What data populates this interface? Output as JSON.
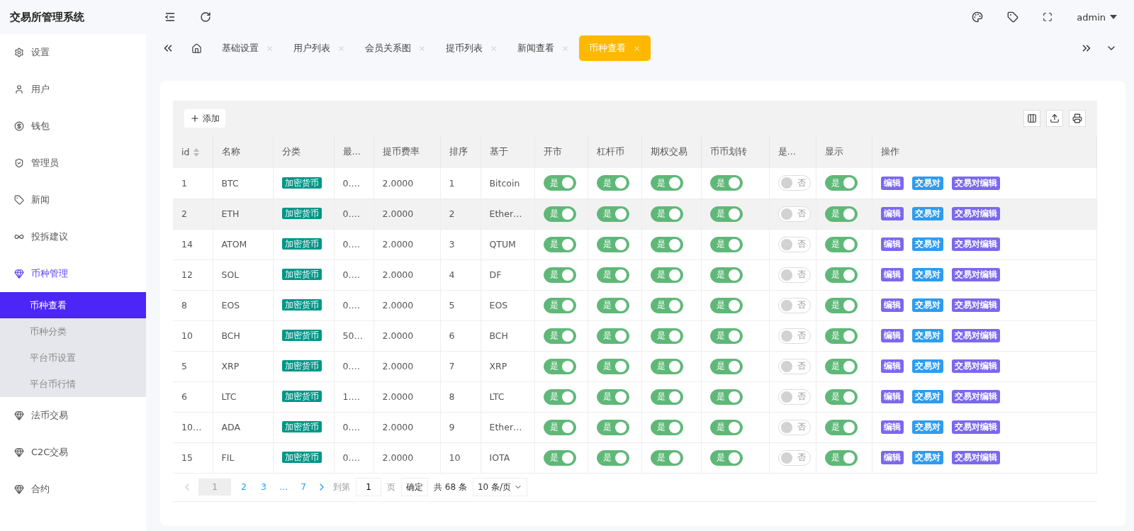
{
  "app": {
    "title": "交易所管理系统"
  },
  "header": {
    "user": "admin"
  },
  "sidebar": {
    "items": [
      {
        "label": "设置",
        "expanded": false
      },
      {
        "label": "用户",
        "expanded": false
      },
      {
        "label": "钱包",
        "expanded": false
      },
      {
        "label": "管理员",
        "expanded": false
      },
      {
        "label": "新闻",
        "expanded": false
      },
      {
        "label": "投拆建议",
        "expanded": false
      },
      {
        "label": "币种管理",
        "expanded": true,
        "children": [
          {
            "label": "币种查看",
            "selected": true
          },
          {
            "label": "币种分类",
            "selected": false
          },
          {
            "label": "平台币设置",
            "selected": false
          },
          {
            "label": "平台币行情",
            "selected": false
          }
        ]
      },
      {
        "label": "法币交易",
        "expanded": false
      },
      {
        "label": "C2C交易",
        "expanded": false
      },
      {
        "label": "合约",
        "expanded": false
      }
    ]
  },
  "tabs": [
    {
      "label": "基础设置",
      "selected": false
    },
    {
      "label": "用户列表",
      "selected": false
    },
    {
      "label": "会员关系图",
      "selected": false
    },
    {
      "label": "提币列表",
      "selected": false
    },
    {
      "label": "新闻查看",
      "selected": false
    },
    {
      "label": "币种查看",
      "selected": true
    }
  ],
  "toolbar": {
    "add": "添加"
  },
  "table": {
    "columns": [
      {
        "label": "id",
        "sortable": true
      },
      {
        "label": "名称",
        "sortable": false
      },
      {
        "label": "分类",
        "sortable": false
      },
      {
        "label": "最…",
        "sortable": false
      },
      {
        "label": "提币费率",
        "sortable": false
      },
      {
        "label": "排序",
        "sortable": false
      },
      {
        "label": "基于",
        "sortable": false
      },
      {
        "label": "开市",
        "sortable": false
      },
      {
        "label": "杠杆币",
        "sortable": false
      },
      {
        "label": "期权交易",
        "sortable": false
      },
      {
        "label": "币币划转",
        "sortable": false
      },
      {
        "label": "是…",
        "sortable": false
      },
      {
        "label": "显示",
        "sortable": false
      },
      {
        "label": "操作",
        "sortable": false
      }
    ],
    "rows": [
      {
        "hovered": false,
        "id": "1",
        "name": "BTC",
        "category": "加密货币",
        "column_4": "0.…",
        "fee": "2.0000",
        "order": "1",
        "base": "Bitcoin",
        "switches": [
          {
            "label": "是",
            "on": true
          },
          {
            "label": "是",
            "on": true
          },
          {
            "label": "是",
            "on": true
          },
          {
            "label": "是",
            "on": true
          },
          {
            "label": "否",
            "on": false
          },
          {
            "label": "是",
            "on": true
          }
        ],
        "actions": [
          {
            "label": "编辑",
            "kind": "edit"
          },
          {
            "label": "交易对",
            "kind": "pairs"
          },
          {
            "label": "交易对编辑",
            "kind": "edit"
          }
        ]
      },
      {
        "hovered": true,
        "id": "2",
        "name": "ETH",
        "category": "加密货币",
        "column_4": "0.…",
        "fee": "2.0000",
        "order": "2",
        "base": "Ether…",
        "switches": [
          {
            "label": "是",
            "on": true
          },
          {
            "label": "是",
            "on": true
          },
          {
            "label": "是",
            "on": true
          },
          {
            "label": "是",
            "on": true
          },
          {
            "label": "否",
            "on": false
          },
          {
            "label": "是",
            "on": true
          }
        ],
        "actions": [
          {
            "label": "编辑",
            "kind": "edit"
          },
          {
            "label": "交易对",
            "kind": "pairs"
          },
          {
            "label": "交易对编辑",
            "kind": "edit"
          }
        ]
      },
      {
        "hovered": false,
        "id": "14",
        "name": "ATOM",
        "category": "加密货币",
        "column_4": "0.…",
        "fee": "2.0000",
        "order": "3",
        "base": "QTUM",
        "switches": [
          {
            "label": "是",
            "on": true
          },
          {
            "label": "是",
            "on": true
          },
          {
            "label": "是",
            "on": true
          },
          {
            "label": "是",
            "on": true
          },
          {
            "label": "否",
            "on": false
          },
          {
            "label": "是",
            "on": true
          }
        ],
        "actions": [
          {
            "label": "编辑",
            "kind": "edit"
          },
          {
            "label": "交易对",
            "kind": "pairs"
          },
          {
            "label": "交易对编辑",
            "kind": "edit"
          }
        ]
      },
      {
        "hovered": false,
        "id": "12",
        "name": "SOL",
        "category": "加密货币",
        "column_4": "0.…",
        "fee": "2.0000",
        "order": "4",
        "base": "DF",
        "switches": [
          {
            "label": "是",
            "on": true
          },
          {
            "label": "是",
            "on": true
          },
          {
            "label": "是",
            "on": true
          },
          {
            "label": "是",
            "on": true
          },
          {
            "label": "否",
            "on": false
          },
          {
            "label": "是",
            "on": true
          }
        ],
        "actions": [
          {
            "label": "编辑",
            "kind": "edit"
          },
          {
            "label": "交易对",
            "kind": "pairs"
          },
          {
            "label": "交易对编辑",
            "kind": "edit"
          }
        ]
      },
      {
        "hovered": false,
        "id": "8",
        "name": "EOS",
        "category": "加密货币",
        "column_4": "0.…",
        "fee": "2.0000",
        "order": "5",
        "base": "EOS",
        "switches": [
          {
            "label": "是",
            "on": true
          },
          {
            "label": "是",
            "on": true
          },
          {
            "label": "是",
            "on": true
          },
          {
            "label": "是",
            "on": true
          },
          {
            "label": "否",
            "on": false
          },
          {
            "label": "是",
            "on": true
          }
        ],
        "actions": [
          {
            "label": "编辑",
            "kind": "edit"
          },
          {
            "label": "交易对",
            "kind": "pairs"
          },
          {
            "label": "交易对编辑",
            "kind": "edit"
          }
        ]
      },
      {
        "hovered": false,
        "id": "10",
        "name": "BCH",
        "category": "加密货币",
        "column_4": "50…",
        "fee": "2.0000",
        "order": "6",
        "base": "BCH",
        "switches": [
          {
            "label": "是",
            "on": true
          },
          {
            "label": "是",
            "on": true
          },
          {
            "label": "是",
            "on": true
          },
          {
            "label": "是",
            "on": true
          },
          {
            "label": "否",
            "on": false
          },
          {
            "label": "是",
            "on": true
          }
        ],
        "actions": [
          {
            "label": "编辑",
            "kind": "edit"
          },
          {
            "label": "交易对",
            "kind": "pairs"
          },
          {
            "label": "交易对编辑",
            "kind": "edit"
          }
        ]
      },
      {
        "hovered": false,
        "id": "5",
        "name": "XRP",
        "category": "加密货币",
        "column_4": "0.…",
        "fee": "2.0000",
        "order": "7",
        "base": "XRP",
        "switches": [
          {
            "label": "是",
            "on": true
          },
          {
            "label": "是",
            "on": true
          },
          {
            "label": "是",
            "on": true
          },
          {
            "label": "是",
            "on": true
          },
          {
            "label": "否",
            "on": false
          },
          {
            "label": "是",
            "on": true
          }
        ],
        "actions": [
          {
            "label": "编辑",
            "kind": "edit"
          },
          {
            "label": "交易对",
            "kind": "pairs"
          },
          {
            "label": "交易对编辑",
            "kind": "edit"
          }
        ]
      },
      {
        "hovered": false,
        "id": "6",
        "name": "LTC",
        "category": "加密货币",
        "column_4": "1.…",
        "fee": "2.0000",
        "order": "8",
        "base": "LTC",
        "switches": [
          {
            "label": "是",
            "on": true
          },
          {
            "label": "是",
            "on": true
          },
          {
            "label": "是",
            "on": true
          },
          {
            "label": "是",
            "on": true
          },
          {
            "label": "否",
            "on": false
          },
          {
            "label": "是",
            "on": true
          }
        ],
        "actions": [
          {
            "label": "编辑",
            "kind": "edit"
          },
          {
            "label": "交易对",
            "kind": "pairs"
          },
          {
            "label": "交易对编辑",
            "kind": "edit"
          }
        ]
      },
      {
        "hovered": false,
        "id": "10…",
        "name": "ADA",
        "category": "加密货币",
        "column_4": "0.…",
        "fee": "2.0000",
        "order": "9",
        "base": "Ether…",
        "switches": [
          {
            "label": "是",
            "on": true
          },
          {
            "label": "是",
            "on": true
          },
          {
            "label": "是",
            "on": true
          },
          {
            "label": "是",
            "on": true
          },
          {
            "label": "否",
            "on": false
          },
          {
            "label": "是",
            "on": true
          }
        ],
        "actions": [
          {
            "label": "编辑",
            "kind": "edit"
          },
          {
            "label": "交易对",
            "kind": "pairs"
          },
          {
            "label": "交易对编辑",
            "kind": "edit"
          }
        ]
      },
      {
        "hovered": false,
        "id": "15",
        "name": "FIL",
        "category": "加密货币",
        "column_4": "0.…",
        "fee": "2.0000",
        "order": "10",
        "base": "IOTA",
        "switches": [
          {
            "label": "是",
            "on": true
          },
          {
            "label": "是",
            "on": true
          },
          {
            "label": "是",
            "on": true
          },
          {
            "label": "是",
            "on": true
          },
          {
            "label": "否",
            "on": false
          },
          {
            "label": "是",
            "on": true
          }
        ],
        "actions": [
          {
            "label": "编辑",
            "kind": "edit"
          },
          {
            "label": "交易对",
            "kind": "pairs"
          },
          {
            "label": "交易对编辑",
            "kind": "edit"
          }
        ]
      }
    ]
  },
  "pagination": {
    "pages": [
      {
        "label": "1",
        "selected": true
      },
      {
        "label": "2",
        "selected": false
      },
      {
        "label": "3",
        "selected": false
      },
      {
        "label": "…",
        "selected": false
      },
      {
        "label": "7",
        "selected": false
      }
    ],
    "goto_label": "到第",
    "goto_value": "1",
    "page_unit": "页",
    "confirm": "确定",
    "total": "共 68 条",
    "page_size": "10 条/页"
  }
}
